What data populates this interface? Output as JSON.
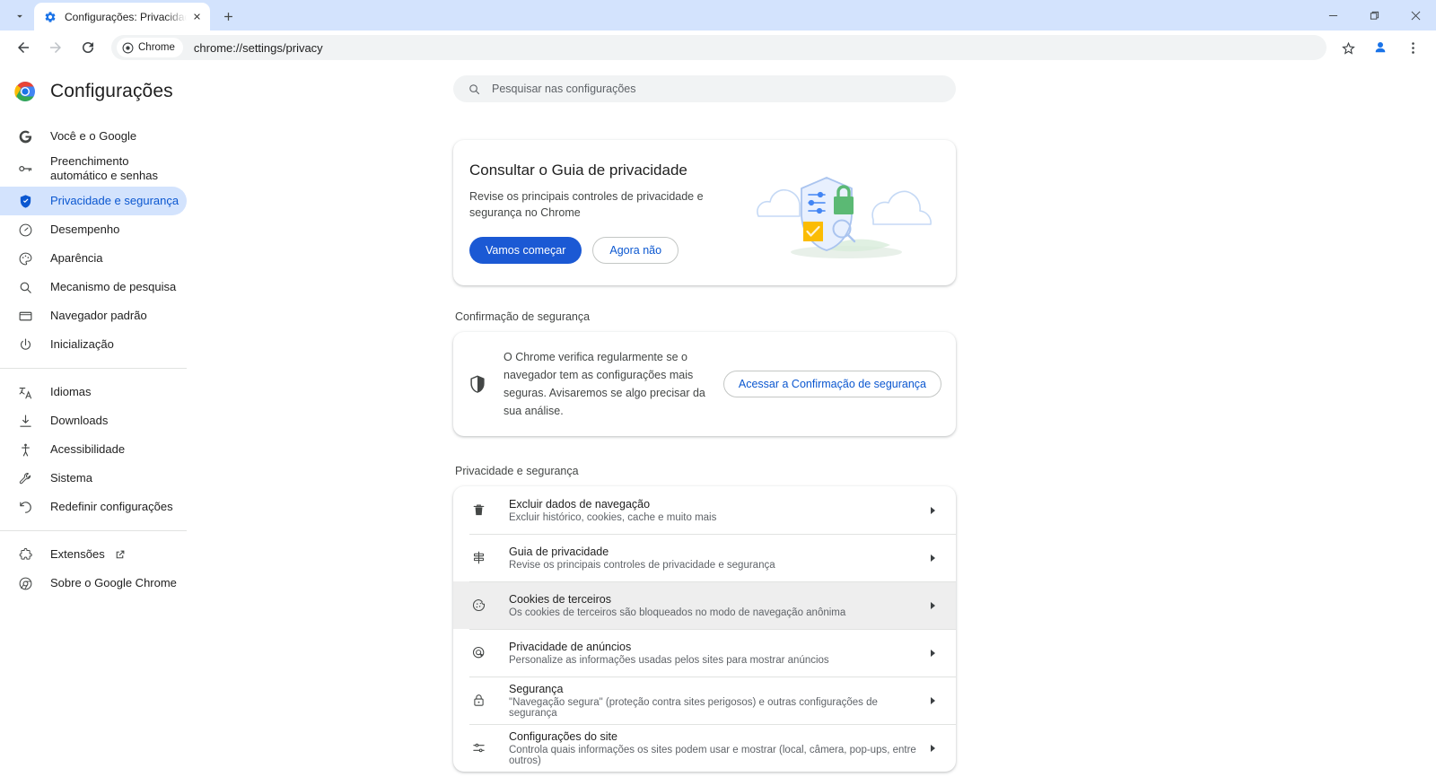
{
  "browser": {
    "tab": {
      "title": "Configurações: Privacidade e se",
      "favicon_name": "settings-gear-icon",
      "close_label": "✕"
    },
    "tab_search_name": "tab-search-icon",
    "new_tab_label": "+",
    "window_controls": {
      "minimize": "minimize-icon",
      "maximize": "maximize-icon",
      "close": "close-icon"
    },
    "toolbar": {
      "back": "back-arrow-icon",
      "forward": "forward-arrow-icon",
      "reload": "reload-icon",
      "chip_label": "Chrome",
      "url": "chrome://settings/privacy",
      "bookmark": "star-icon",
      "profile": "profile-avatar-icon",
      "menu": "three-dot-menu-icon"
    }
  },
  "sidebar": {
    "brand_title": "Configurações",
    "items": [
      {
        "label": "Você e o Google",
        "icon": "google-g-icon",
        "active": false
      },
      {
        "label": "Preenchimento automático e senhas",
        "icon": "key-icon",
        "active": false
      },
      {
        "label": "Privacidade e segurança",
        "icon": "shield-icon",
        "active": true
      },
      {
        "label": "Desempenho",
        "icon": "speedometer-icon",
        "active": false
      },
      {
        "label": "Aparência",
        "icon": "palette-icon",
        "active": false
      },
      {
        "label": "Mecanismo de pesquisa",
        "icon": "magnifier-icon",
        "active": false
      },
      {
        "label": "Navegador padrão",
        "icon": "window-icon",
        "active": false
      },
      {
        "label": "Inicialização",
        "icon": "power-icon",
        "active": false
      }
    ],
    "items2": [
      {
        "label": "Idiomas",
        "icon": "translate-icon"
      },
      {
        "label": "Downloads",
        "icon": "download-icon"
      },
      {
        "label": "Acessibilidade",
        "icon": "accessibility-icon"
      },
      {
        "label": "Sistema",
        "icon": "wrench-icon"
      },
      {
        "label": "Redefinir configurações",
        "icon": "restore-icon"
      }
    ],
    "items3": [
      {
        "label": "Extensões",
        "icon": "extension-icon",
        "external": true
      },
      {
        "label": "Sobre o Google Chrome",
        "icon": "chrome-icon",
        "external": false
      }
    ]
  },
  "search": {
    "placeholder": "Pesquisar nas configurações",
    "value": "",
    "icon": "search-icon"
  },
  "promo": {
    "title": "Consultar o Guia de privacidade",
    "description": "Revise os principais controles de privacidade e segurança no Chrome",
    "primary_button": "Vamos começar",
    "secondary_button": "Agora não",
    "illustration_name": "privacy-shield-clouds-illustration"
  },
  "safety_check": {
    "section_title": "Confirmação de segurança",
    "description": "O Chrome verifica regularmente se o navegador tem as configurações mais seguras. Avisaremos se algo precisar da sua análise.",
    "button": "Acessar a Confirmação de segurança",
    "icon": "shield-icon"
  },
  "privacy_section": {
    "section_title": "Privacidade e segurança",
    "rows": [
      {
        "title": "Excluir dados de navegação",
        "subtitle": "Excluir histórico, cookies, cache e muito mais",
        "icon": "trash-icon",
        "highlighted": false
      },
      {
        "title": "Guia de privacidade",
        "subtitle": "Revise os principais controles de privacidade e segurança",
        "icon": "privacy-guide-icon",
        "highlighted": false
      },
      {
        "title": "Cookies de terceiros",
        "subtitle": "Os cookies de terceiros são bloqueados no modo de navegação anônima",
        "icon": "cookie-icon",
        "highlighted": true
      },
      {
        "title": "Privacidade de anúncios",
        "subtitle": "Personalize as informações usadas pelos sites para mostrar anúncios",
        "icon": "ad-privacy-icon",
        "highlighted": false
      },
      {
        "title": "Segurança",
        "subtitle": "\"Navegação segura\" (proteção contra sites perigosos) e outras configurações de segurança",
        "icon": "lock-icon",
        "highlighted": false
      },
      {
        "title": "Configurações do site",
        "subtitle": "Controla quais informações os sites podem usar e mostrar (local, câmera, pop-ups, entre outros)",
        "icon": "site-settings-icon",
        "highlighted": false
      }
    ]
  },
  "colors": {
    "accent_blue": "#0b57d0",
    "primary_button": "#1b59d4",
    "tabstrip_bg": "#d3e3fd",
    "active_pill": "#d3e3fd",
    "row_highlight": "#eeeeee",
    "text_primary": "#1f1f1f",
    "text_secondary": "#5f6368"
  }
}
